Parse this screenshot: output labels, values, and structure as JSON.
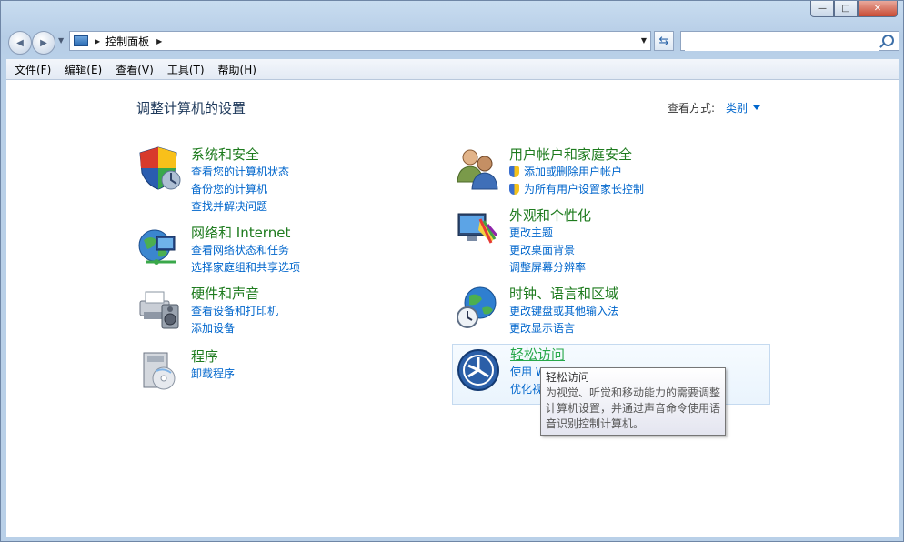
{
  "window": {
    "minimize": "—",
    "maximize": "□",
    "close": "✕"
  },
  "nav": {
    "back_glyph": "◀",
    "forward_glyph": "▶",
    "address_path": "控制面板",
    "search_placeholder": ""
  },
  "menubar": [
    "文件(F)",
    "编辑(E)",
    "查看(V)",
    "工具(T)",
    "帮助(H)"
  ],
  "page": {
    "title": "调整计算机的设置",
    "view_by_label": "查看方式:",
    "view_by_value": "类别"
  },
  "categories": [
    {
      "title": "系统和安全",
      "icon": "shield-icon",
      "links": [
        "查看您的计算机状态",
        "备份您的计算机",
        "查找并解决问题"
      ]
    },
    {
      "title": "用户帐户和家庭安全",
      "icon": "users-icon",
      "links": [
        "添加或删除用户帐户",
        "为所有用户设置家长控制"
      ]
    },
    {
      "title": "网络和 Internet",
      "icon": "network-globe-icon",
      "links": [
        "查看网络状态和任务",
        "选择家庭组和共享选项"
      ]
    },
    {
      "title": "外观和个性化",
      "icon": "display-palette-icon",
      "links": [
        "更改主题",
        "更改桌面背景",
        "调整屏幕分辨率"
      ]
    },
    {
      "title": "硬件和声音",
      "icon": "printer-speaker-icon",
      "links": [
        "查看设备和打印机",
        "添加设备"
      ]
    },
    {
      "title": "时钟、语言和区域",
      "icon": "globe-clock-icon",
      "links": [
        "更改键盘或其他输入法",
        "更改显示语言"
      ]
    },
    {
      "title": "程序",
      "icon": "programs-box-icon",
      "links": [
        "卸载程序"
      ]
    },
    {
      "title": "轻松访问",
      "icon": "ease-of-access-icon",
      "links": [
        "使用 W",
        "优化视"
      ]
    }
  ],
  "tooltip": {
    "title": "轻松访问",
    "body": "为视觉、听觉和移动能力的需要调整计算机设置，并通过声音命令使用语音识别控制计算机。"
  },
  "colors": {
    "category_title": "#1e7b1e",
    "link": "#0066cc",
    "page_title": "#1e395b"
  }
}
